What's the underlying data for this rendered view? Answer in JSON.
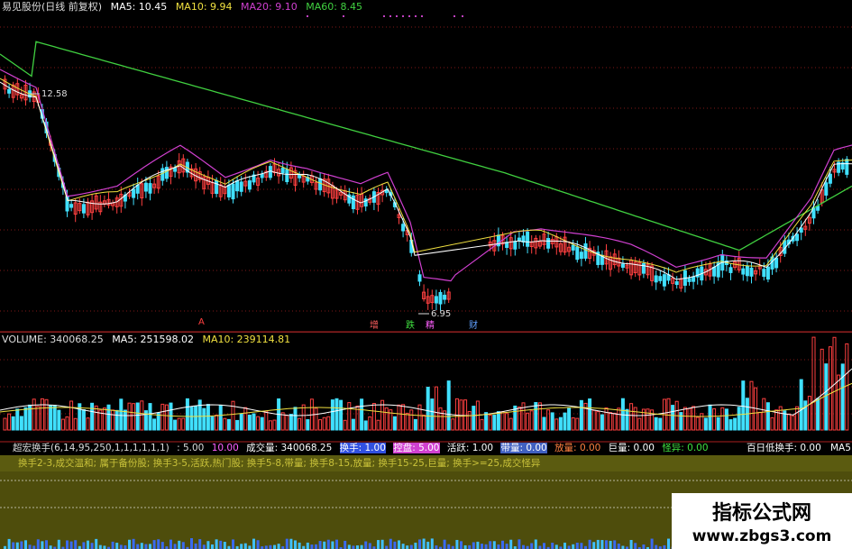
{
  "price_header": {
    "title": "易见股份(日线 前复权)",
    "ma5": "MA5: 10.45",
    "ma10": "MA10: 9.94",
    "ma20": "MA20: 9.10",
    "ma60": "MA60: 8.45"
  },
  "price_annotations": {
    "high_label": "12.58",
    "low_label": "6.95",
    "event_tags": [
      "A",
      "增",
      "跌",
      "精",
      "财"
    ]
  },
  "volume_header": {
    "volume": "VOLUME: 340068.25",
    "ma5": "MA5: 251598.02",
    "ma10": "MA10: 239114.81"
  },
  "turnover_header": {
    "title": "超宏换手(6,14,95,250,1,1,1,1,1,1)",
    "v1": ": 5.00",
    "v2": "10.00",
    "volume": "成交量: 340068.25",
    "huanshou": "换手: 1.00",
    "kongpan": "控盘: 5.00",
    "huoyue": "活跃: 1.00",
    "dailiang": "带量: 0.00",
    "fangliang": "放量: 0.00",
    "juliang": "巨量: 0.00",
    "guaiyi": "怪异: 0.00",
    "bairi": "百日低换手: 0.00",
    "ma5_cut": "MA5"
  },
  "turnover_legend": "换手2-3,成交温和; 属于备份股; 换手3-5,活跃,热门股; 换手5-8,带量; 换手8-15,放量; 换手15-25,巨量; 换手>=25,成交怪异",
  "watermark": {
    "title": "指标公式网",
    "url": "www.zbgs3.com"
  },
  "colors": {
    "ma5": "#ffffff",
    "ma10": "#f0e040",
    "ma20": "#d040d0",
    "ma60": "#40d040",
    "up": "#ff4040",
    "down": "#40e0ff",
    "grid": "#801818"
  }
}
